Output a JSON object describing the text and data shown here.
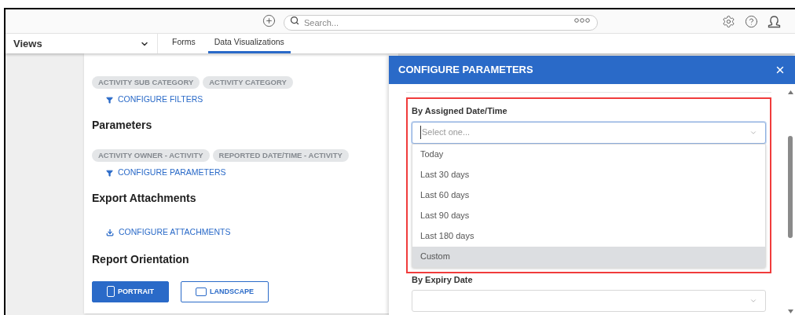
{
  "header": {
    "search": {
      "placeholder": "Search..."
    }
  },
  "nav": {
    "views_label": "Views",
    "tabs": [
      {
        "label": "Forms",
        "selected": false
      },
      {
        "label": "Data Visualizations",
        "selected": true
      }
    ]
  },
  "card": {
    "filter_tags": [
      "ACTIVITY SUB CATEGORY",
      "ACTIVITY CATEGORY"
    ],
    "configure_filters": "CONFIGURE FILTERS",
    "parameters_heading": "Parameters",
    "parameter_tags": [
      "ACTIVITY OWNER - ACTIVITY",
      "REPORTED DATE/TIME - ACTIVITY"
    ],
    "configure_parameters": "CONFIGURE PARAMETERS",
    "attachments_heading": "Export Attachments",
    "configure_attachments": "CONFIGURE ATTACHMENTS",
    "orientation_heading": "Report Orientation",
    "orientation_buttons": [
      {
        "label": "PORTRAIT",
        "selected": true
      },
      {
        "label": "LANDSCAPE",
        "selected": false
      }
    ]
  },
  "panel": {
    "title": "CONFIGURE PARAMETERS",
    "fields": [
      {
        "label": "By Assigned Date/Time",
        "placeholder": "Select one...",
        "expanded": true,
        "options": [
          {
            "label": "Today",
            "selected": false
          },
          {
            "label": "Last 30 days",
            "selected": false
          },
          {
            "label": "Last 60 days",
            "selected": false
          },
          {
            "label": "Last 90 days",
            "selected": false
          },
          {
            "label": "Last 180 days",
            "selected": false
          },
          {
            "label": "Custom",
            "selected": true
          }
        ]
      },
      {
        "label": "By Expiry Date",
        "expanded": false
      }
    ]
  }
}
